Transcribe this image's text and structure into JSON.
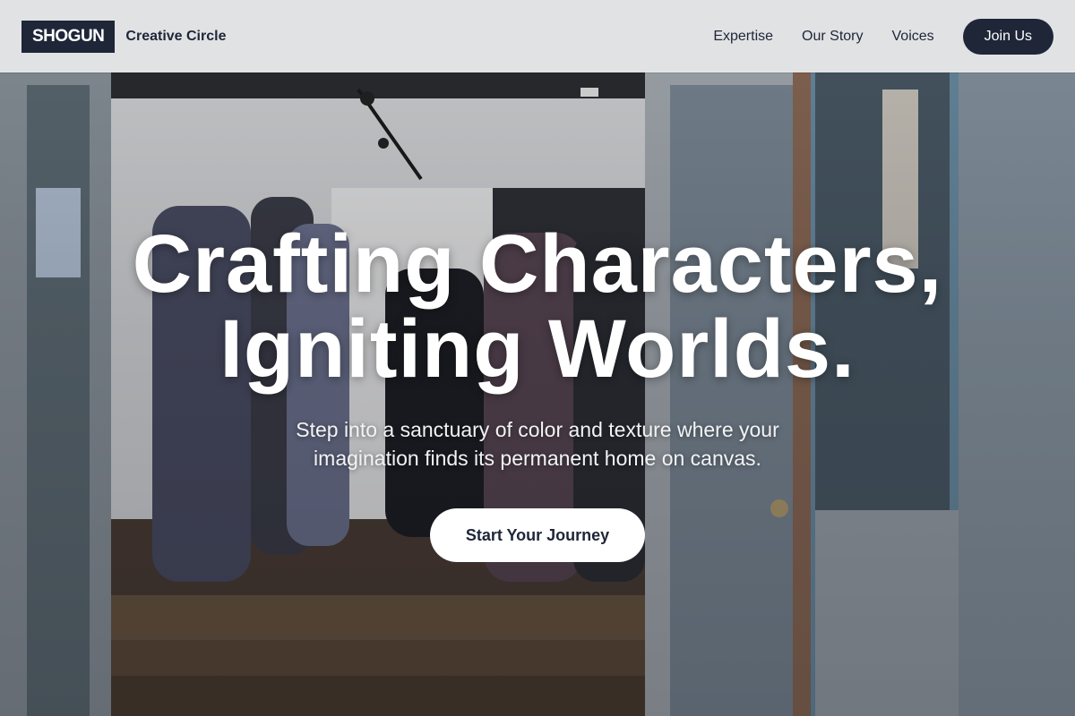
{
  "colors": {
    "brand_navy": "#1e2638",
    "navbar_bg": "#ecedef",
    "hero_text": "#ffffff",
    "cta_bg": "#ffffff"
  },
  "navbar": {
    "logo": "SHOGUN",
    "brand_subtitle": "Creative Circle",
    "links": [
      {
        "label": "Expertise"
      },
      {
        "label": "Our Story"
      },
      {
        "label": "Voices"
      }
    ],
    "join_label": "Join Us"
  },
  "hero": {
    "background_image": "gallery-doorway-photo",
    "title_line1": "Crafting Characters,",
    "title_line2": "Igniting Worlds.",
    "subtitle": "Step into a sanctuary of color and texture where your imagination finds its permanent home on canvas.",
    "cta_label": "Start Your Journey"
  }
}
